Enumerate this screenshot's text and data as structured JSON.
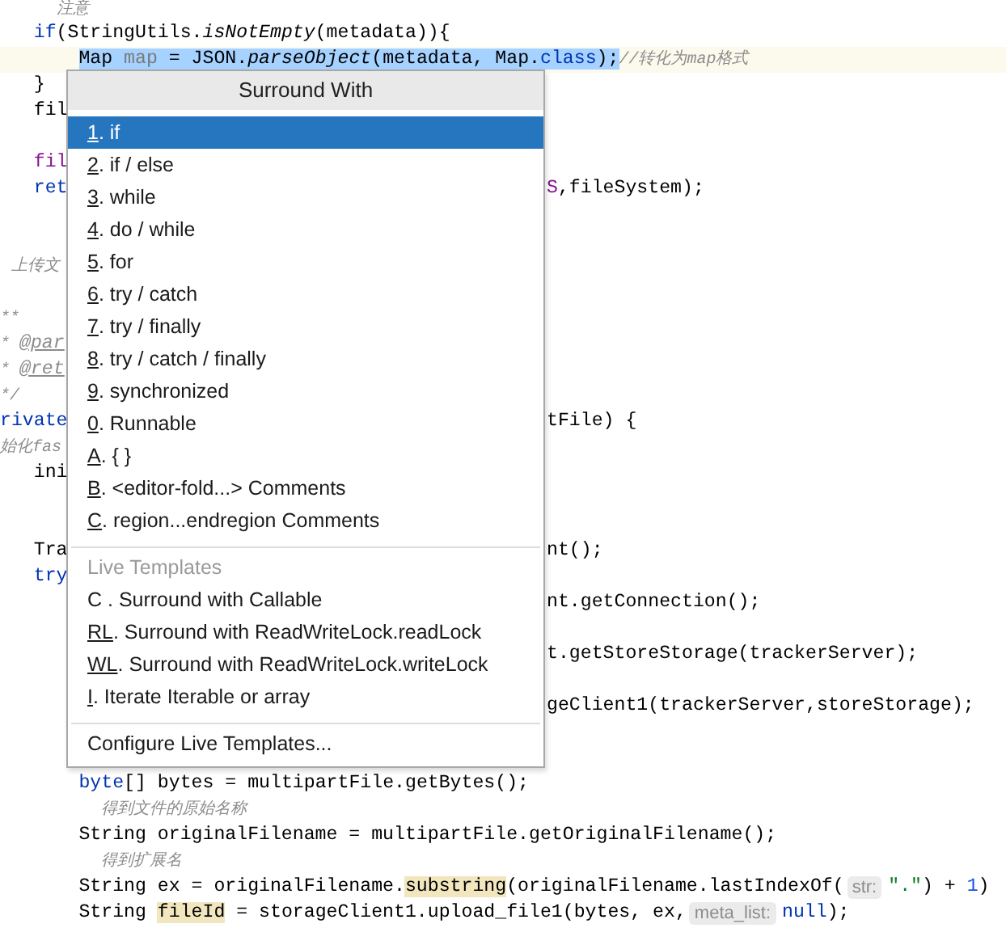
{
  "editor": {
    "lines": [
      {
        "kind": "code",
        "left": [
          {
            "text": "     注意",
            "kind": "comment"
          }
        ]
      },
      {
        "kind": "code",
        "left": [
          {
            "text": "   if",
            "kind": "keyword"
          },
          {
            "text": "(StringUtils.",
            "kind": "plain"
          },
          {
            "text": "isNotEmpty",
            "kind": "static"
          },
          {
            "text": "(metadata)){",
            "kind": "plain"
          }
        ]
      },
      {
        "kind": "current",
        "left": [
          {
            "text": "       Map ",
            "kind": "plain",
            "selected": true
          },
          {
            "text": "map",
            "kind": "unused",
            "selected": true
          },
          {
            "text": " = JSON.",
            "kind": "plain",
            "selected": true
          },
          {
            "text": "parseObject",
            "kind": "static",
            "selected": true
          },
          {
            "text": "(metadata, Map.",
            "kind": "plain",
            "selected": true
          },
          {
            "text": "class",
            "kind": "keyword",
            "selected": true
          },
          {
            "text": ");",
            "kind": "plain",
            "selected": true
          },
          {
            "text": "//转化为map格式",
            "kind": "comment",
            "selected": false
          }
        ]
      },
      {
        "kind": "code",
        "left": [
          {
            "text": "   }",
            "kind": "plain"
          }
        ]
      },
      {
        "kind": "code",
        "left": [
          {
            "text": "   fil",
            "kind": "plain"
          }
        ]
      },
      {
        "kind": "blank"
      },
      {
        "kind": "code",
        "left": [
          {
            "text": "   fil",
            "kind": "field"
          }
        ]
      },
      {
        "kind": "code",
        "left": [
          {
            "text": "   ret",
            "kind": "keyword"
          }
        ],
        "right": [
          {
            "text": "S",
            "kind": "field"
          },
          {
            "text": ",fileSystem);",
            "kind": "plain"
          }
        ]
      },
      {
        "kind": "blank"
      },
      {
        "kind": "blank"
      },
      {
        "kind": "code",
        "left": [
          {
            "text": " 上传文",
            "kind": "comment"
          }
        ]
      },
      {
        "kind": "blank"
      },
      {
        "kind": "code",
        "left": [
          {
            "text": "**",
            "kind": "comment"
          }
        ]
      },
      {
        "kind": "code",
        "left": [
          {
            "text": "* ",
            "kind": "comment"
          },
          {
            "text": "@par",
            "kind": "doctag"
          }
        ]
      },
      {
        "kind": "code",
        "left": [
          {
            "text": "* ",
            "kind": "comment"
          },
          {
            "text": "@ret",
            "kind": "doctag"
          }
        ]
      },
      {
        "kind": "code",
        "left": [
          {
            "text": "*/",
            "kind": "comment"
          }
        ]
      },
      {
        "kind": "code",
        "left": [
          {
            "text": "rivate",
            "kind": "keyword"
          }
        ],
        "right": [
          {
            "text": "tFile) {",
            "kind": "plain"
          }
        ]
      },
      {
        "kind": "code",
        "left": [
          {
            "text": "始化fas",
            "kind": "comment"
          }
        ]
      },
      {
        "kind": "code",
        "left": [
          {
            "text": "   ini",
            "kind": "plain"
          }
        ]
      },
      {
        "kind": "blank"
      },
      {
        "kind": "blank"
      },
      {
        "kind": "code",
        "left": [
          {
            "text": "   Tra",
            "kind": "plain"
          }
        ],
        "right": [
          {
            "text": "nt();",
            "kind": "plain"
          }
        ]
      },
      {
        "kind": "code",
        "left": [
          {
            "text": "   try",
            "kind": "keyword"
          }
        ]
      },
      {
        "kind": "code",
        "right": [
          {
            "text": "nt.getConnection();",
            "kind": "plain"
          }
        ]
      },
      {
        "kind": "blank"
      },
      {
        "kind": "code",
        "right": [
          {
            "text": "t.getStoreStorage(trackerServer);",
            "kind": "plain"
          }
        ]
      },
      {
        "kind": "blank"
      },
      {
        "kind": "code",
        "right": [
          {
            "text": "geClient1(trackerServer,storeStorage);",
            "kind": "plain"
          }
        ]
      },
      {
        "kind": "blank"
      },
      {
        "kind": "blank"
      },
      {
        "kind": "code",
        "left": [
          {
            "text": "       byte",
            "kind": "keyword"
          },
          {
            "text": "[] bytes = multipartFile.getBytes();",
            "kind": "plain"
          }
        ]
      },
      {
        "kind": "code",
        "left": [
          {
            "text": "         得到文件的原始名称",
            "kind": "comment"
          }
        ]
      },
      {
        "kind": "code",
        "left": [
          {
            "text": "       String originalFilename = multipartFile.getOriginalFilename();",
            "kind": "plain"
          }
        ]
      },
      {
        "kind": "code",
        "left": [
          {
            "text": "         得到扩展名",
            "kind": "comment"
          }
        ]
      },
      {
        "kind": "code",
        "left": [
          {
            "text": "       String ex = originalFilename.",
            "kind": "plain"
          },
          {
            "text": "substring",
            "kind": "usage"
          },
          {
            "text": "(originalFilename.lastIndexOf(",
            "kind": "plain"
          },
          {
            "text": "str:",
            "kind": "hint"
          },
          {
            "text": "\".\"",
            "kind": "string"
          },
          {
            "text": ") + ",
            "kind": "plain"
          },
          {
            "text": "1",
            "kind": "number"
          },
          {
            "text": ")",
            "kind": "plain"
          }
        ]
      },
      {
        "kind": "code",
        "left": [
          {
            "text": "       String ",
            "kind": "plain"
          },
          {
            "text": "fileId",
            "kind": "usage"
          },
          {
            "text": " = storageClient1.upload_file1(bytes, ex,",
            "kind": "plain"
          },
          {
            "text": "meta_list:",
            "kind": "hint"
          },
          {
            "text": "null",
            "kind": "keyword"
          },
          {
            "text": ");",
            "kind": "plain"
          }
        ]
      }
    ]
  },
  "popup": {
    "title": "Surround With",
    "groups": [
      {
        "items": [
          {
            "key": "1",
            "text": ". if",
            "selected": true
          },
          {
            "key": "2",
            "text": ". if / else",
            "selected": false
          },
          {
            "key": "3",
            "text": ". while",
            "selected": false
          },
          {
            "key": "4",
            "text": ". do / while",
            "selected": false
          },
          {
            "key": "5",
            "text": ". for",
            "selected": false
          },
          {
            "key": "6",
            "text": ". try / catch",
            "selected": false
          },
          {
            "key": "7",
            "text": ". try / finally",
            "selected": false
          },
          {
            "key": "8",
            "text": ". try / catch / finally",
            "selected": false
          },
          {
            "key": "9",
            "text": ". synchronized",
            "selected": false
          },
          {
            "key": "0",
            "text": ". Runnable",
            "selected": false
          },
          {
            "key": "A",
            "text": ". { }",
            "selected": false
          },
          {
            "key": "B",
            "text": ". <editor-fold...> Comments",
            "selected": false
          },
          {
            "key": "C",
            "text": ". region...endregion Comments",
            "selected": false
          }
        ]
      },
      {
        "title": "Live Templates",
        "items": [
          {
            "text": "C . Surround with Callable",
            "selected": false
          },
          {
            "key": "RL",
            "text": ". Surround with ReadWriteLock.readLock",
            "selected": false
          },
          {
            "key": "WL",
            "text": ". Surround with ReadWriteLock.writeLock",
            "selected": false
          },
          {
            "key": "I",
            "text": ". Iterate Iterable or array",
            "selected": false
          }
        ]
      },
      {
        "items": [
          {
            "text": "Configure Live Templates...",
            "selected": false
          }
        ]
      }
    ]
  }
}
